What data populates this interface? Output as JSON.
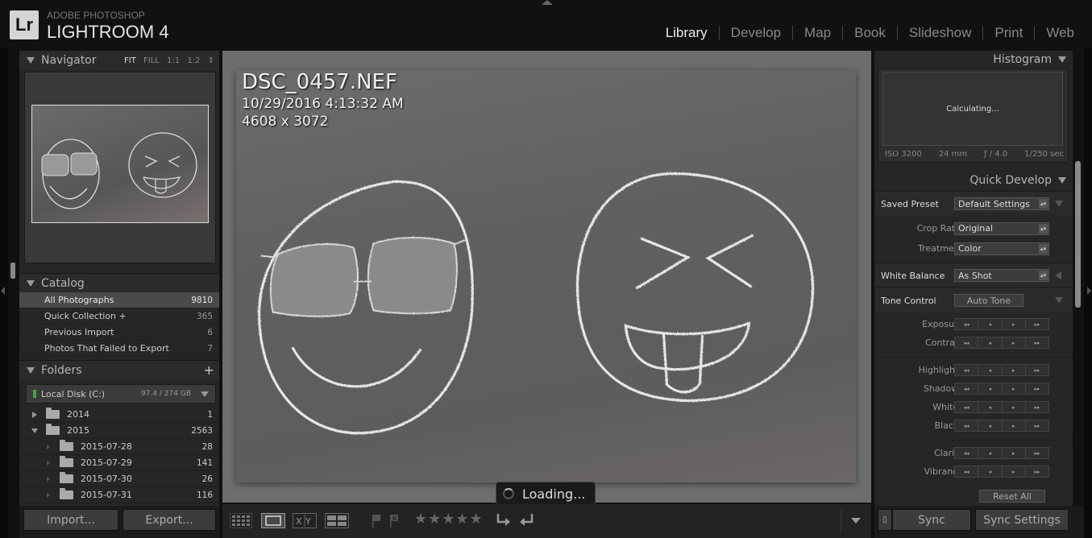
{
  "app": {
    "brand_top": "ADOBE PHOTOSHOP",
    "brand_name": "LIGHTROOM 4",
    "logo": "Lr"
  },
  "modules": [
    "Library",
    "Develop",
    "Map",
    "Book",
    "Slideshow",
    "Print",
    "Web"
  ],
  "active_module": "Library",
  "navigator": {
    "title": "Navigator",
    "options": [
      "FIT",
      "FILL",
      "1:1",
      "1:2"
    ],
    "active": "FIT"
  },
  "catalog": {
    "title": "Catalog",
    "items": [
      {
        "label": "All Photographs",
        "count": "9810"
      },
      {
        "label": "Quick Collection +",
        "count": "365"
      },
      {
        "label": "Previous Import",
        "count": "6"
      },
      {
        "label": "Photos That Failed to Export",
        "count": "7"
      }
    ]
  },
  "folders": {
    "title": "Folders",
    "add": "+",
    "disk": {
      "name": "Local Disk (C:)",
      "size": "97.4 / 274 GB"
    },
    "items": [
      {
        "label": "2014",
        "count": "1"
      },
      {
        "label": "2015",
        "count": "2563"
      },
      {
        "label": "2015-07-28",
        "count": "28"
      },
      {
        "label": "2015-07-29",
        "count": "141"
      },
      {
        "label": "2015-07-30",
        "count": "26"
      },
      {
        "label": "2015-07-31",
        "count": "116"
      }
    ]
  },
  "left_buttons": {
    "import": "Import...",
    "export": "Export..."
  },
  "photo": {
    "filename": "DSC_0457.NEF",
    "datetime": "10/29/2016 4:13:32 AM",
    "dimensions": "4608 x 3072",
    "loading": "Loading..."
  },
  "toolbar": {
    "stars": "★★★★★"
  },
  "histogram": {
    "title": "Histogram",
    "status": "Calculating...",
    "iso": "ISO 3200",
    "focal": "24 mm",
    "aperture": "ƒ / 4.0",
    "shutter": "1/250 sec"
  },
  "quick_develop": {
    "title": "Quick Develop",
    "saved_preset": {
      "label": "Saved Preset",
      "value": "Default Settings"
    },
    "crop_ratio": {
      "label": "Crop Ratio",
      "value": "Original"
    },
    "treatment": {
      "label": "Treatment",
      "value": "Color"
    },
    "white_balance": {
      "label": "White Balance",
      "value": "As Shot"
    },
    "tone_control": {
      "label": "Tone Control",
      "button": "Auto Tone"
    },
    "sliders": [
      "Exposure",
      "Contrast",
      "Highlights",
      "Shadows",
      "Whites",
      "Blacks",
      "Clarity",
      "Vibrance"
    ],
    "reset": "Reset All"
  },
  "right_buttons": {
    "sync": "Sync",
    "sync_settings": "Sync Settings"
  }
}
